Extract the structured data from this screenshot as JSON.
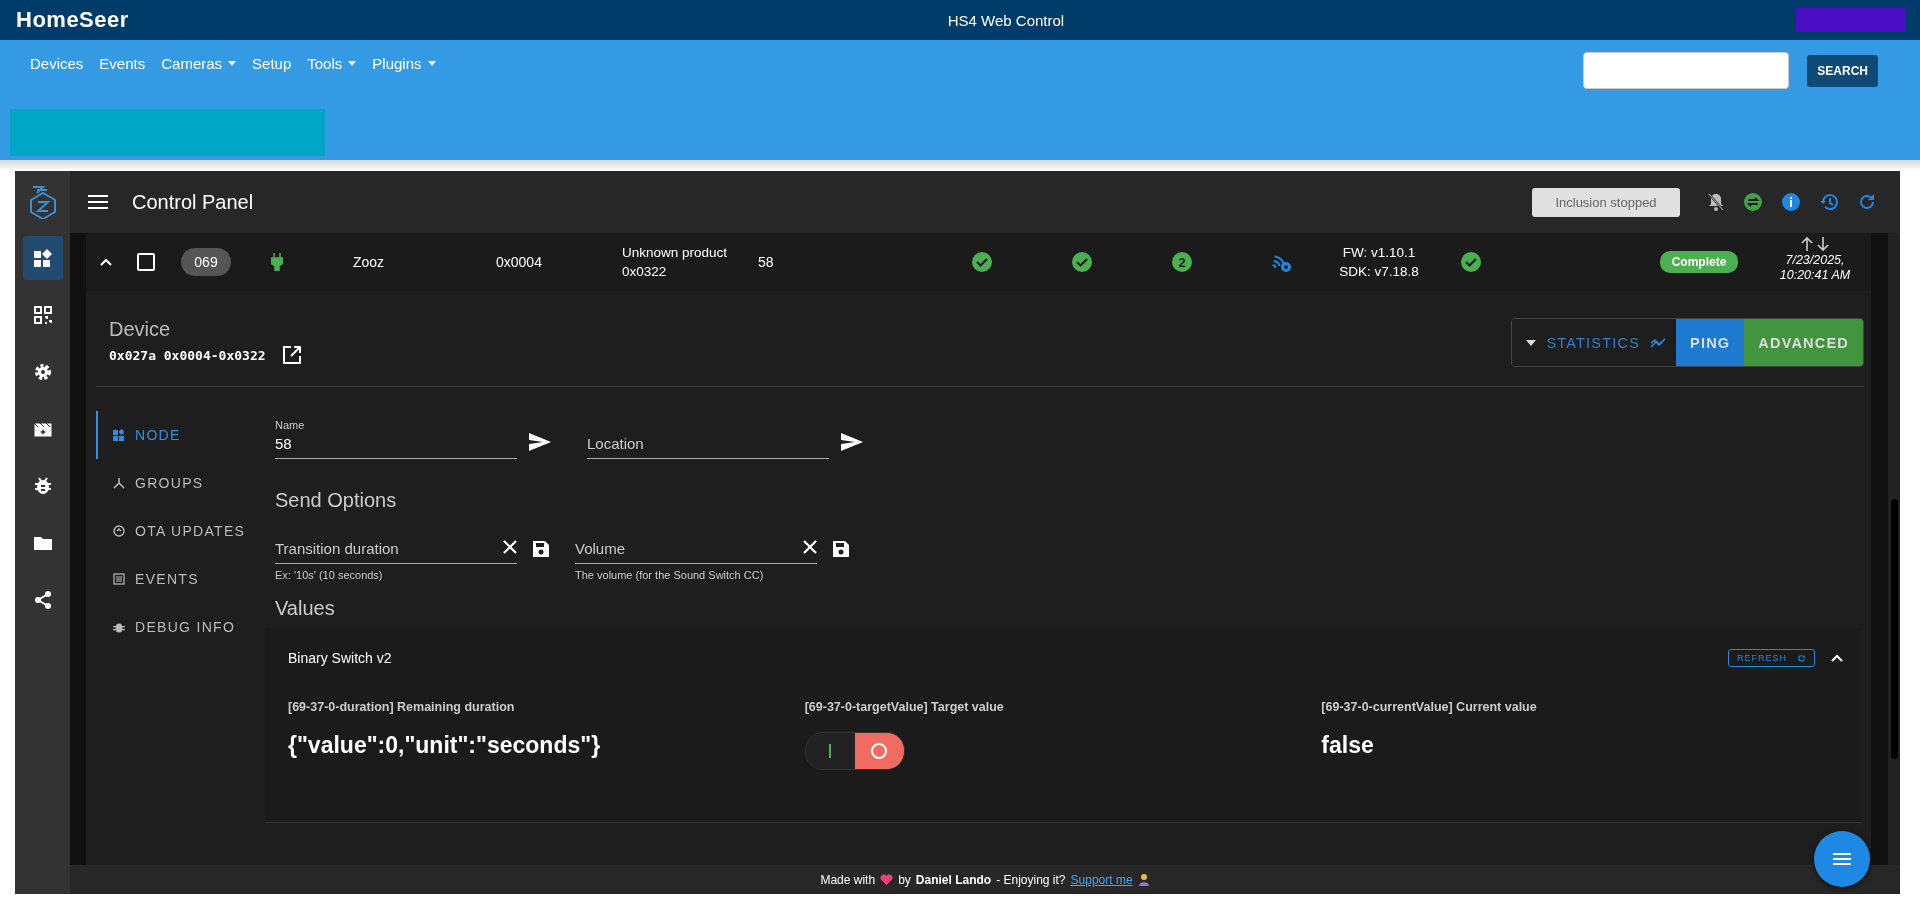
{
  "top_bar": {
    "logo": "HomeSeer",
    "title": "HS4 Web Control"
  },
  "nav": {
    "items": [
      {
        "label": "Devices",
        "dropdown": false
      },
      {
        "label": "Events",
        "dropdown": false
      },
      {
        "label": "Cameras",
        "dropdown": true
      },
      {
        "label": "Setup",
        "dropdown": false
      },
      {
        "label": "Tools",
        "dropdown": true
      },
      {
        "label": "Plugins",
        "dropdown": true
      }
    ],
    "search_button": "SEARCH"
  },
  "header": {
    "title": "Control Panel",
    "inclusion_status": "Inclusion stopped"
  },
  "rail": [
    {
      "selected": true
    },
    {
      "selected": false
    },
    {
      "selected": false
    },
    {
      "selected": false
    },
    {
      "selected": false
    },
    {
      "selected": false
    },
    {
      "selected": false
    }
  ],
  "node_row": {
    "expanded": true,
    "checked": false,
    "id": "069",
    "manufacturer": "Zooz",
    "product_code": "0x0004",
    "product": [
      "Unknown product",
      "0x0322"
    ],
    "name": "58",
    "security_level": "2",
    "firmware": [
      "FW: v1.10.1",
      "SDK: v7.18.8"
    ],
    "status": "Complete",
    "last_active": [
      "7/23/2025,",
      "10:20:41 AM"
    ]
  },
  "device": {
    "title": "Device",
    "ids": "0x027a 0x0004-0x0322",
    "buttons": [
      {
        "label": "STATISTICS",
        "kind": "outline"
      },
      {
        "label": "PING",
        "kind": "primary"
      },
      {
        "label": "ADVANCED",
        "kind": "success"
      }
    ]
  },
  "tabs": [
    {
      "label": "NODE",
      "selected": true
    },
    {
      "label": "GROUPS",
      "selected": false
    },
    {
      "label": "OTA UPDATES",
      "selected": false
    },
    {
      "label": "EVENTS",
      "selected": false
    },
    {
      "label": "DEBUG INFO",
      "selected": false
    }
  ],
  "name_field": {
    "label": "Name",
    "value": "58"
  },
  "location_field": {
    "placeholder": "Location"
  },
  "send_options": {
    "title": "Send Options",
    "fields": [
      {
        "placeholder": "Transition duration",
        "hint": "Ex: '10s' (10 seconds)"
      },
      {
        "placeholder": "Volume",
        "hint": "The volume (for the Sound Switch CC)"
      }
    ]
  },
  "values": {
    "title": "Values",
    "group": {
      "title": "Binary Switch v2",
      "refresh": "REFRESH",
      "expanded": true,
      "items": [
        {
          "kind": "text",
          "label": "[69-37-0-duration] Remaining duration",
          "value": "{\"value\":0,\"unit\":\"seconds\"}"
        },
        {
          "kind": "switch",
          "label": "[69-37-0-targetValue] Target value",
          "on": false
        },
        {
          "kind": "text",
          "label": "[69-37-0-currentValue] Current value",
          "value": "false"
        }
      ]
    }
  },
  "footer": {
    "made_with": "Made with",
    "by": "by",
    "author": "Daniel Lando",
    "enjoy": "- Enjoying it?",
    "link": "Support me"
  }
}
